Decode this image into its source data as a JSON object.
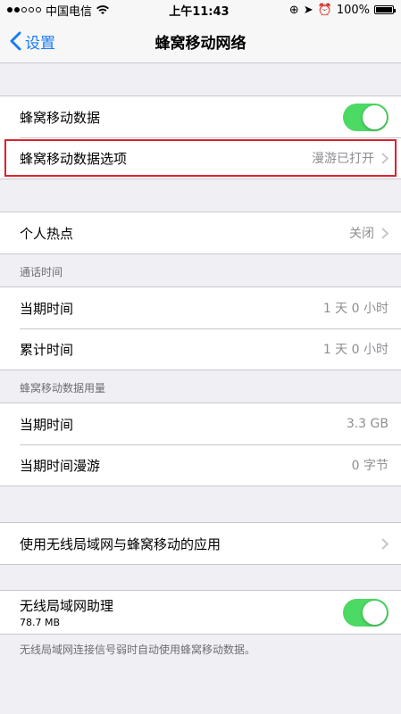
{
  "status_bar": {
    "carrier": "中国电信",
    "time": "上午11:43",
    "battery": "100%"
  },
  "nav": {
    "back_label": "设置",
    "title": "蜂窝移动网络"
  },
  "section1": {
    "cellular_data_label": "蜂窝移动数据",
    "cellular_data_on": true,
    "options_label": "蜂窝移动数据选项",
    "options_value": "漫游已打开"
  },
  "section2": {
    "hotspot_label": "个人热点",
    "hotspot_value": "关闭"
  },
  "call_time": {
    "header": "通话时间",
    "current_label": "当期时间",
    "current_value": "1 天 0 小时",
    "total_label": "累计时间",
    "total_value": "1 天 0 小时"
  },
  "usage": {
    "header": "蜂窝移动数据用量",
    "current_label": "当期时间",
    "current_value": "3.3 GB",
    "roaming_label": "当期时间漫游",
    "roaming_value": "0 字节"
  },
  "section_apps": {
    "apps_label": "使用无线局域网与蜂窝移动的应用"
  },
  "wifi_assist": {
    "label": "无线局域网助理",
    "size": "78.7 MB",
    "on": true,
    "footer": "无线局域网连接信号弱时自动使用蜂窝移动数据。"
  },
  "colors": {
    "accent": "#1a7cf5",
    "toggle_on": "#4cd964",
    "highlight": "#d9232e"
  }
}
